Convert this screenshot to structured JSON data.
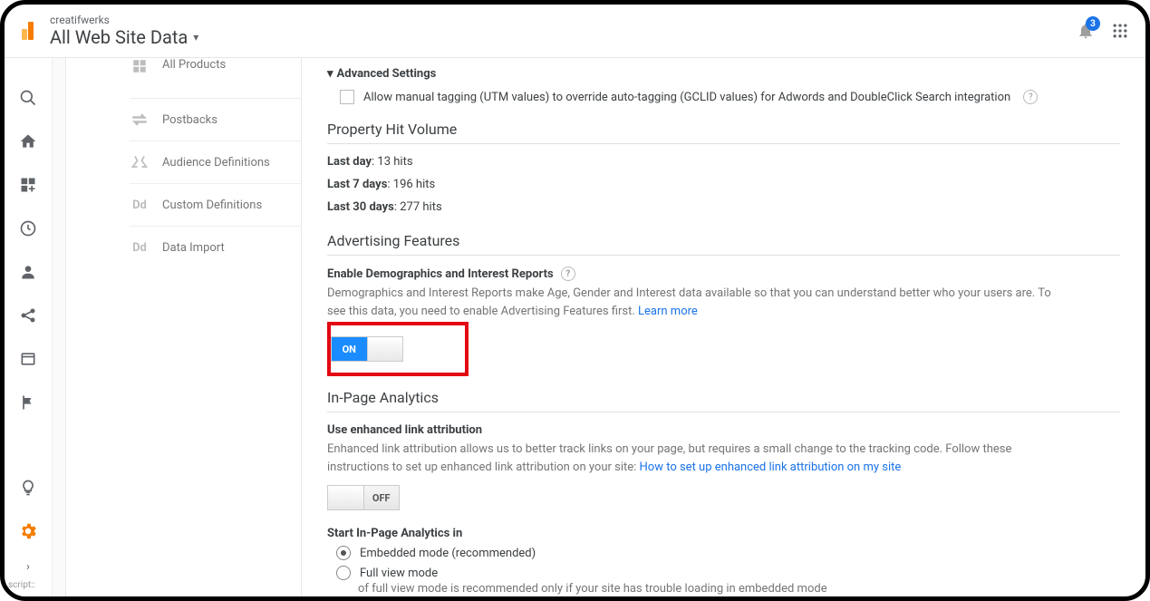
{
  "header": {
    "account": "creatifwerks",
    "view": "All Web Site Data",
    "notification_count": "3"
  },
  "sidebar": {
    "items": [
      {
        "label": "All Products"
      },
      {
        "label": "Postbacks"
      },
      {
        "label": "Audience Definitions"
      },
      {
        "label": "Custom Definitions"
      },
      {
        "label": "Data Import"
      }
    ]
  },
  "advanced": {
    "title": "Advanced Settings",
    "checkbox_label": "Allow manual tagging (UTM values) to override auto-tagging (GCLID values) for Adwords and DoubleClick Search integration"
  },
  "hits": {
    "title": "Property Hit Volume",
    "rows": [
      {
        "label": "Last day",
        "value": "13 hits"
      },
      {
        "label": "Last 7 days",
        "value": "196 hits"
      },
      {
        "label": "Last 30 days",
        "value": "277 hits"
      }
    ]
  },
  "advertising": {
    "title": "Advertising Features",
    "sub": "Enable Demographics and Interest Reports",
    "desc": "Demographics and Interest Reports make Age, Gender and Interest data available so that you can understand better who your users are. To see this data, you need to enable Advertising Features first. ",
    "link": "Learn more",
    "toggle_on": "ON"
  },
  "inpage": {
    "title": "In-Page Analytics",
    "link_sub": "Use enhanced link attribution",
    "link_desc": "Enhanced link attribution allows us to better track links on your page, but requires a small change to the tracking code. Follow these instructions to set up enhanced link attribution on your site: ",
    "link_link": "How to set up enhanced link attribution on my site",
    "toggle_off": "OFF",
    "start_label": "Start In-Page Analytics in",
    "radio1": "Embedded mode (recommended)",
    "radio2": "Full view mode",
    "radio2_note": "of full view mode is recommended only if your site has trouble loading in embedded mode"
  },
  "footer_script": "script::"
}
